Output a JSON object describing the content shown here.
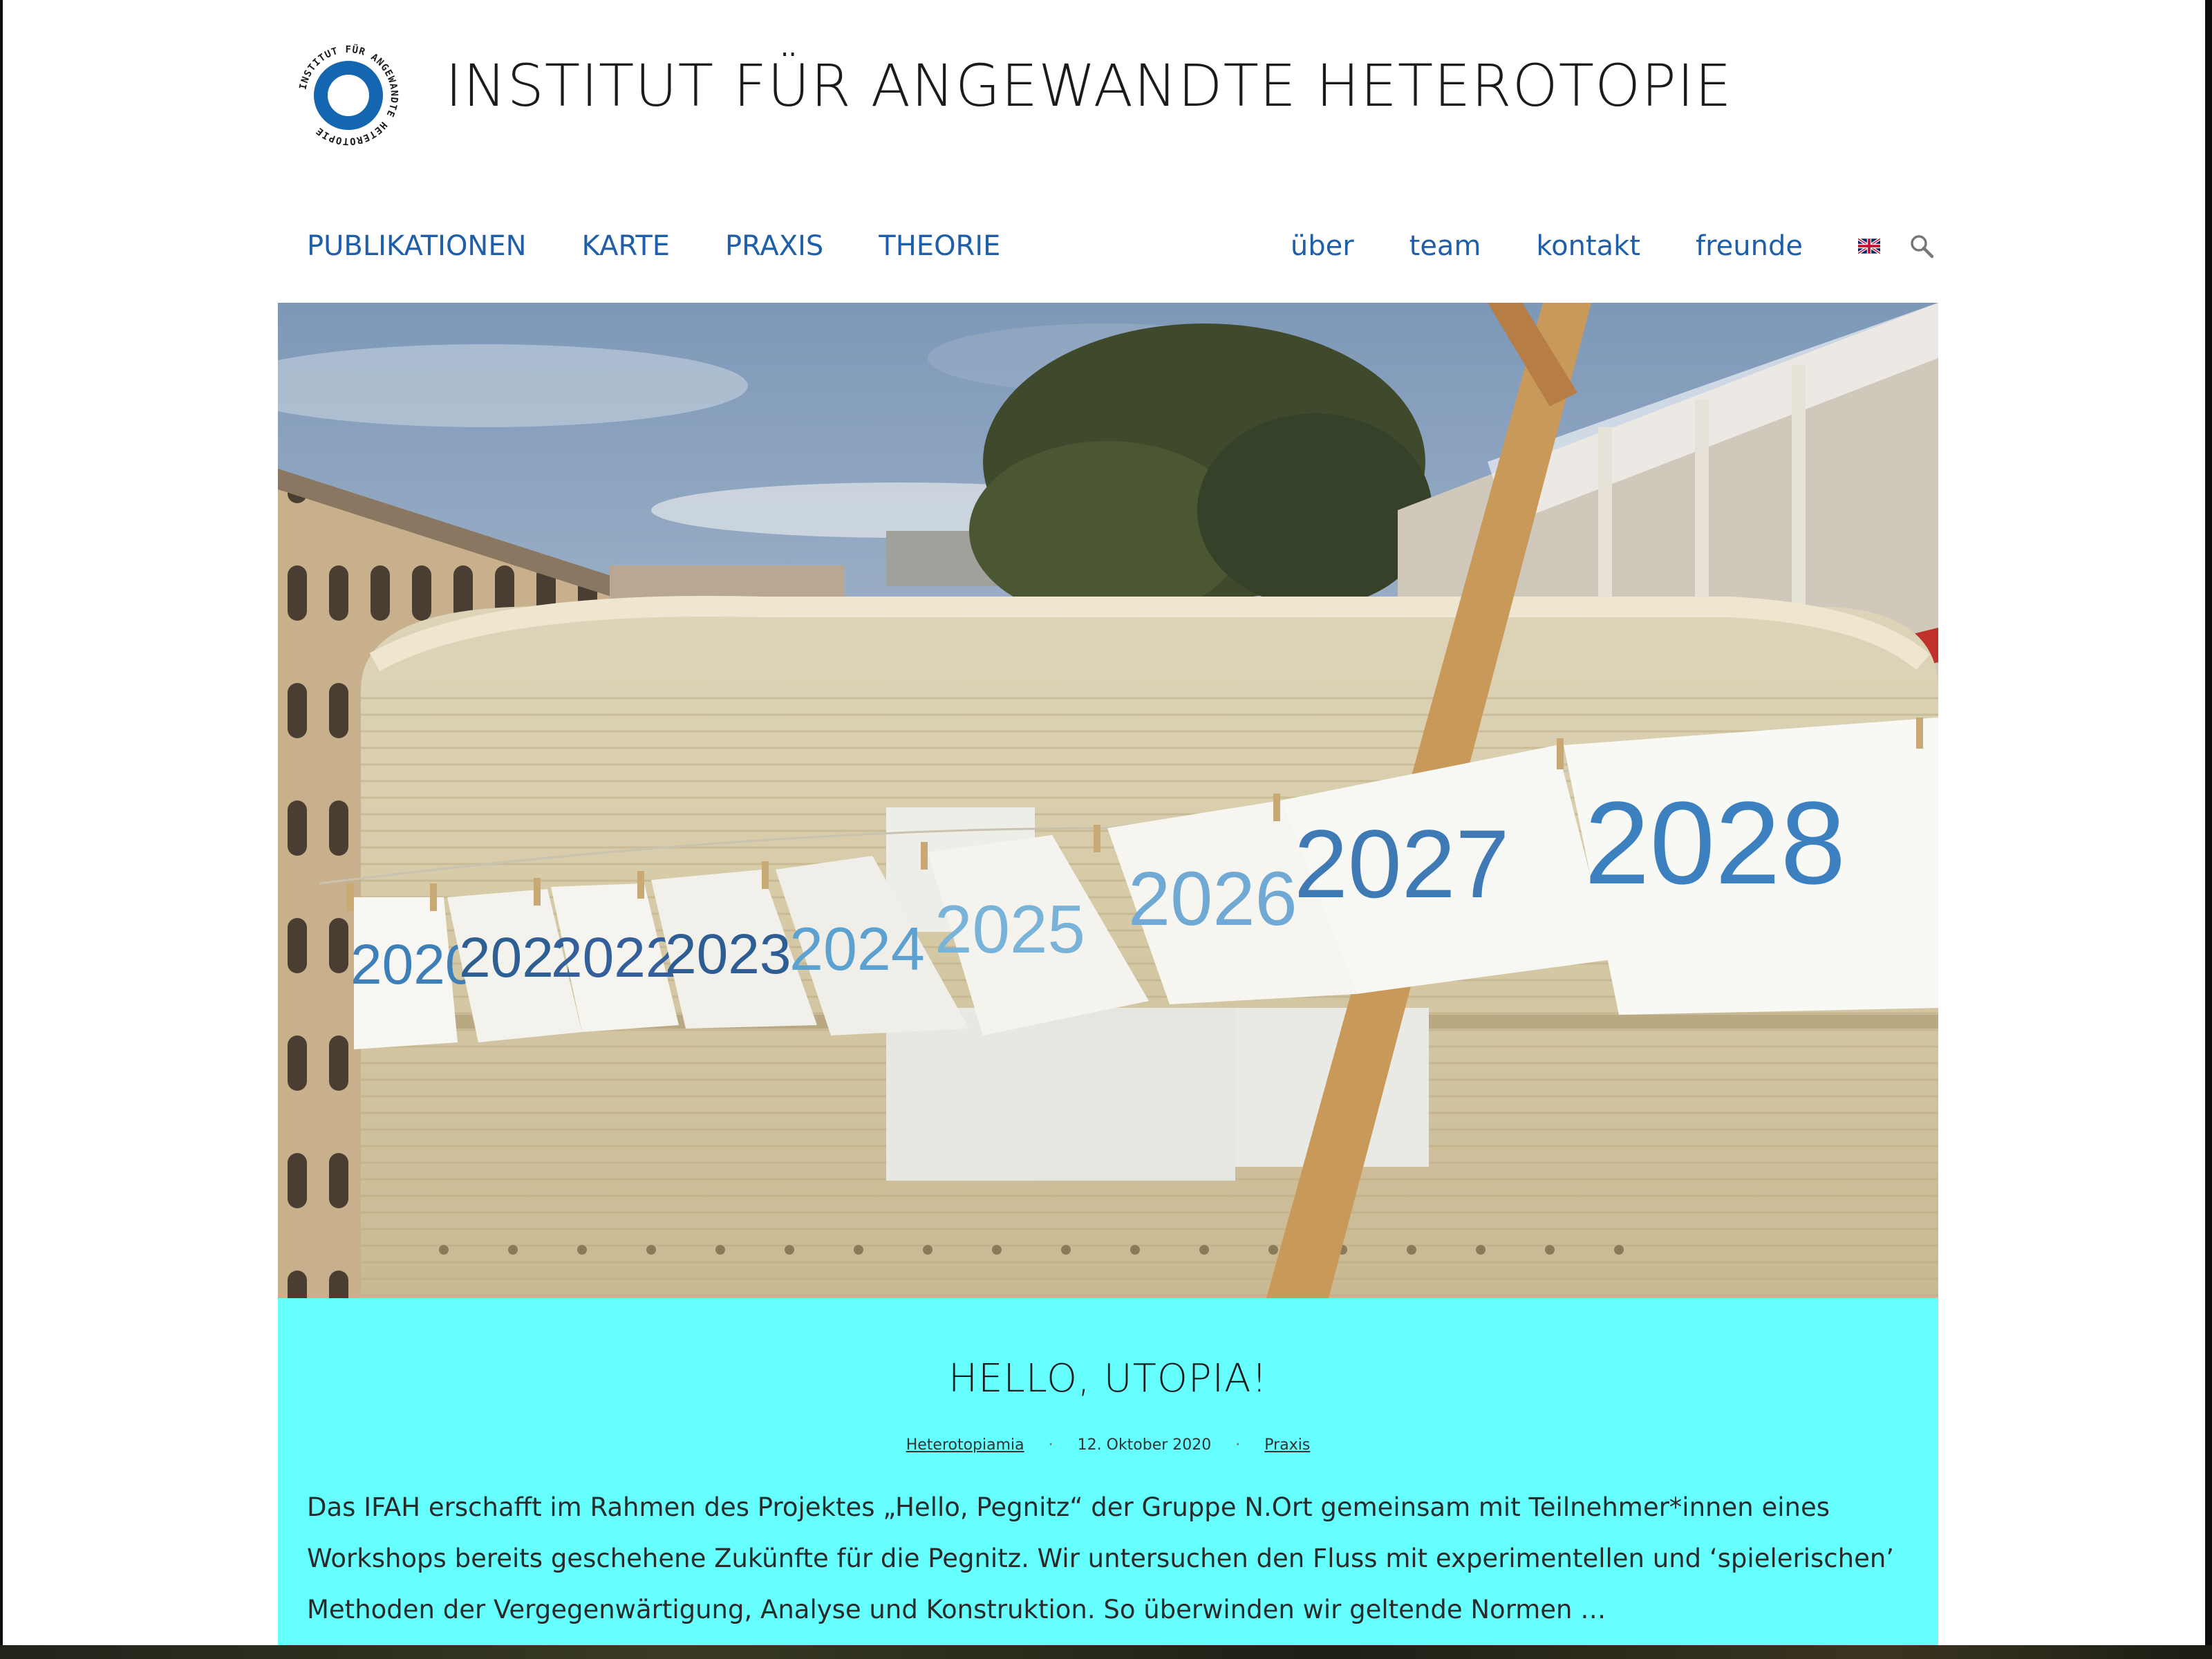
{
  "header": {
    "title": "INSTITUT FÜR ANGEWANDTE HETEROTOPIE",
    "logo_text": "INSTITUT FÜR ANGEWANDTE HETEROTOPIE"
  },
  "nav": {
    "left": [
      "PUBLIKATIONEN",
      "KARTE",
      "PRAXIS",
      "THEORIE"
    ],
    "right": [
      "über",
      "team",
      "kontakt",
      "freunde"
    ],
    "language_flag": "uk-flag-icon",
    "search": "search-icon"
  },
  "hero": {
    "image_subject": "Caravan with clothesline of year papers",
    "year_papers": [
      "2020",
      "2021",
      "2022",
      "2023",
      "2024",
      "2025",
      "2026",
      "2027",
      "2028"
    ]
  },
  "post": {
    "title": "HELLO, UTOPIA!",
    "author": "Heterotopiamia",
    "date": "12. Oktober 2020",
    "category": "Praxis",
    "excerpt": "Das IFAH erschafft im Rahmen des Projektes „Hello, Pegnitz“ der Gruppe N.Ort gemeinsam mit Teilnehmer*innen eines Workshops bereits geschehene Zukünfte für die Pegnitz. Wir untersuchen den Fluss mit experimentellen und ‘spielerischen’ Methoden der Vergegenwärtigung, Analyse und Konstruktion. So überwinden wir geltende Normen …",
    "card_color": "#66ffff"
  },
  "colors": {
    "nav_link": "#1f5ea8",
    "logo_blue": "#1566b0",
    "title_text": "#1b1b1b"
  }
}
